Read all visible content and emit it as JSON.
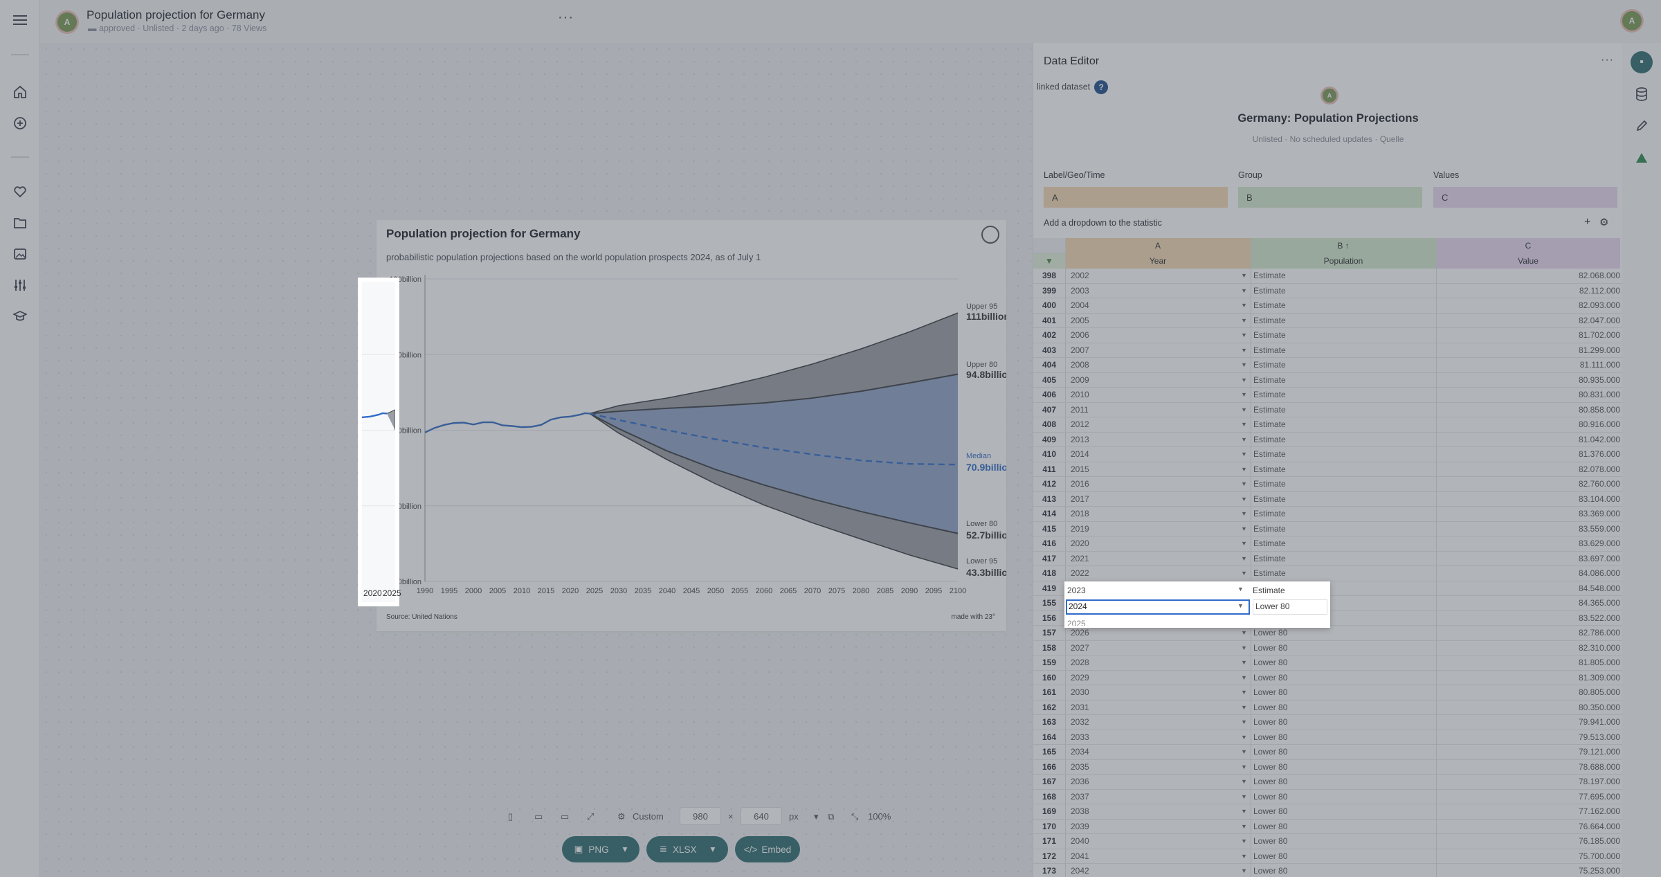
{
  "topbar": {
    "title": "Population projection for Germany",
    "folder": "approved",
    "status": "Unlisted",
    "age": "2 days ago",
    "views": "78 Views",
    "avatar": "A"
  },
  "chart": {
    "title": "Population projection for Germany",
    "subtitle": "probabilistic population projections based on the world population prospects 2024, as of July 1",
    "source": "Source: United Nations",
    "made": "made with 23°"
  },
  "chart_data": {
    "type": "line",
    "title": "Population projection for Germany",
    "x_ticks": [
      "1990",
      "1995",
      "2000",
      "2005",
      "2010",
      "2015",
      "2020",
      "2025",
      "2030",
      "2035",
      "2040",
      "2045",
      "2050",
      "2055",
      "2060",
      "2065",
      "2070",
      "2075",
      "2080",
      "2085",
      "2090",
      "2095",
      "2100"
    ],
    "y_ticks": [
      "40billion",
      "60billion",
      "80billion",
      "100billion",
      "120billion"
    ],
    "ylim": [
      40,
      120
    ],
    "grid": true,
    "series": [
      {
        "name": "Estimate",
        "x": [
          1990,
          1992,
          1994,
          1996,
          1998,
          2000,
          2002,
          2004,
          2006,
          2008,
          2010,
          2012,
          2014,
          2016,
          2018,
          2020,
          2022,
          2023,
          2024
        ],
        "y": [
          79.4,
          80.6,
          81.4,
          81.9,
          82.0,
          81.5,
          82.1,
          82.1,
          81.3,
          81.1,
          80.8,
          80.9,
          81.4,
          82.8,
          83.4,
          83.6,
          84.1,
          84.5,
          84.4
        ]
      },
      {
        "name": "Median",
        "x": [
          2024,
          2030,
          2040,
          2050,
          2060,
          2070,
          2080,
          2090,
          2100
        ],
        "y": [
          84.4,
          82.7,
          80.0,
          77.6,
          75.4,
          73.6,
          72.0,
          71.1,
          70.9
        ]
      },
      {
        "name": "Upper 95",
        "x": [
          2024,
          2030,
          2040,
          2050,
          2060,
          2070,
          2080,
          2090,
          2100
        ],
        "y": [
          84.4,
          86.5,
          88.5,
          91.0,
          94.0,
          97.5,
          101.5,
          106.0,
          111.0
        ]
      },
      {
        "name": "Upper 80",
        "x": [
          2024,
          2030,
          2040,
          2050,
          2060,
          2070,
          2080,
          2090,
          2100
        ],
        "y": [
          84.4,
          85.0,
          85.8,
          86.4,
          87.2,
          88.5,
          90.3,
          92.5,
          94.8
        ]
      },
      {
        "name": "Lower 80",
        "x": [
          2024,
          2030,
          2040,
          2050,
          2060,
          2070,
          2080,
          2090,
          2100
        ],
        "y": [
          84.4,
          80.4,
          74.5,
          69.6,
          65.5,
          61.8,
          58.5,
          55.5,
          52.7
        ]
      },
      {
        "name": "Lower 95",
        "x": [
          2024,
          2030,
          2040,
          2050,
          2060,
          2070,
          2080,
          2090,
          2100
        ],
        "y": [
          84.4,
          79.2,
          72.2,
          65.8,
          60.2,
          55.5,
          51.2,
          47.0,
          43.3
        ]
      }
    ],
    "end_labels": [
      {
        "name": "Upper 95",
        "value": "111billion"
      },
      {
        "name": "Upper 80",
        "value": "94.8billion"
      },
      {
        "name": "Median",
        "value": "70.9billion"
      },
      {
        "name": "Lower 80",
        "value": "52.7billion"
      },
      {
        "name": "Lower 95",
        "value": "43.3billion"
      }
    ],
    "colors": {
      "estimate": "#2f6bc9",
      "median": "#2f6bc9",
      "band_inner": "#8fa4c7",
      "band_outer": "#9a9ea6",
      "line": "#3a3d44"
    }
  },
  "editor": {
    "title": "Data Editor",
    "linked": "linked dataset",
    "help": "?",
    "avatar": "A",
    "dataset_title": "Germany: Population Projections",
    "dataset_meta": "Unlisted · No scheduled updates · Quelle",
    "mapping": [
      {
        "label": "Label/Geo/Time",
        "value": "A",
        "color": "#f4d9b3"
      },
      {
        "label": "Group",
        "value": "B",
        "color": "#d6ebcf"
      },
      {
        "label": "Values",
        "value": "C",
        "color": "#eadaf3"
      }
    ],
    "add_dropdown": "Add a dropdown to the statistic",
    "add_symbol": "+",
    "columns": [
      {
        "letter": "A",
        "name": "Year"
      },
      {
        "letter": "B ↑",
        "name": "Population"
      },
      {
        "letter": "C",
        "name": "Value"
      }
    ],
    "rows_top": [
      [
        "398",
        "2002",
        "Estimate",
        "82.068.000"
      ],
      [
        "399",
        "2003",
        "Estimate",
        "82.112.000"
      ],
      [
        "400",
        "2004",
        "Estimate",
        "82.093.000"
      ],
      [
        "401",
        "2005",
        "Estimate",
        "82.047.000"
      ],
      [
        "402",
        "2006",
        "Estimate",
        "81.702.000"
      ],
      [
        "403",
        "2007",
        "Estimate",
        "81.299.000"
      ],
      [
        "404",
        "2008",
        "Estimate",
        "81.111.000"
      ],
      [
        "405",
        "2009",
        "Estimate",
        "80.935.000"
      ],
      [
        "406",
        "2010",
        "Estimate",
        "80.831.000"
      ],
      [
        "407",
        "2011",
        "Estimate",
        "80.858.000"
      ],
      [
        "408",
        "2012",
        "Estimate",
        "80.916.000"
      ],
      [
        "409",
        "2013",
        "Estimate",
        "81.042.000"
      ],
      [
        "410",
        "2014",
        "Estimate",
        "81.376.000"
      ],
      [
        "411",
        "2015",
        "Estimate",
        "82.078.000"
      ],
      [
        "412",
        "2016",
        "Estimate",
        "82.760.000"
      ],
      [
        "413",
        "2017",
        "Estimate",
        "83.104.000"
      ],
      [
        "414",
        "2018",
        "Estimate",
        "83.369.000"
      ],
      [
        "415",
        "2019",
        "Estimate",
        "83.559.000"
      ],
      [
        "416",
        "2020",
        "Estimate",
        "83.629.000"
      ],
      [
        "417",
        "2021",
        "Estimate",
        "83.697.000"
      ],
      [
        "418",
        "2022",
        "Estimate",
        "84.086.000"
      ],
      [
        "419",
        "2023",
        "Estimate",
        "84.548.000"
      ],
      [
        "155",
        "2024",
        "Lower 80",
        "84.365.000"
      ],
      [
        "156",
        "2025",
        "Lower 80",
        "83.522.000"
      ],
      [
        "157",
        "2026",
        "Lower 80",
        "82.786.000"
      ],
      [
        "158",
        "2027",
        "Lower 80",
        "82.310.000"
      ],
      [
        "159",
        "2028",
        "Lower 80",
        "81.805.000"
      ],
      [
        "160",
        "2029",
        "Lower 80",
        "81.309.000"
      ],
      [
        "161",
        "2030",
        "Lower 80",
        "80.805.000"
      ],
      [
        "162",
        "2031",
        "Lower 80",
        "80.350.000"
      ],
      [
        "163",
        "2032",
        "Lower 80",
        "79.941.000"
      ],
      [
        "164",
        "2033",
        "Lower 80",
        "79.513.000"
      ],
      [
        "165",
        "2034",
        "Lower 80",
        "79.121.000"
      ],
      [
        "166",
        "2035",
        "Lower 80",
        "78.688.000"
      ],
      [
        "167",
        "2036",
        "Lower 80",
        "78.197.000"
      ],
      [
        "168",
        "2037",
        "Lower 80",
        "77.695.000"
      ],
      [
        "169",
        "2038",
        "Lower 80",
        "77.162.000"
      ],
      [
        "170",
        "2039",
        "Lower 80",
        "76.664.000"
      ],
      [
        "171",
        "2040",
        "Lower 80",
        "76.185.000"
      ],
      [
        "172",
        "2041",
        "Lower 80",
        "75.700.000"
      ],
      [
        "173",
        "2042",
        "Lower 80",
        "75.253.000"
      ]
    ],
    "popup": {
      "row1_year": "2023",
      "row1_group": "Estimate",
      "row2_year": "2024",
      "row2_group": "Lower 80",
      "row3_partial": "2025"
    }
  },
  "bottom": {
    "size_preset": "Custom",
    "width": "980",
    "x": "×",
    "height": "640",
    "unit": "px",
    "zoom": "100%"
  },
  "buttons": {
    "png": "PNG",
    "xlsx": "XLSX",
    "embed": "Embed"
  }
}
